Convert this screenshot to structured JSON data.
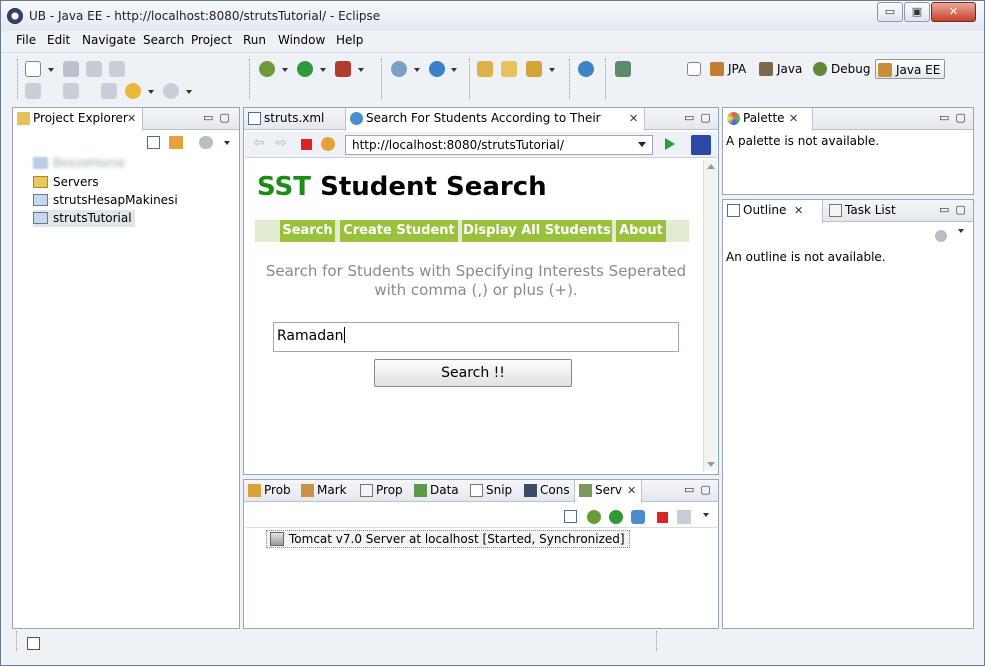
{
  "window": {
    "title": "UB - Java EE - http://localhost:8080/strutsTutorial/ - Eclipse",
    "controls": [
      "▭",
      "▣",
      "✕"
    ]
  },
  "menu": [
    "File",
    "Edit",
    "Navigate",
    "Search",
    "Project",
    "Run",
    "Window",
    "Help"
  ],
  "perspectives": [
    {
      "label": "JPA",
      "icon": "jpa-perspective-icon"
    },
    {
      "label": "Java",
      "icon": "java-perspective-icon"
    },
    {
      "label": "Debug",
      "icon": "debug-perspective-icon"
    },
    {
      "label": "Java EE",
      "icon": "javaee-perspective-icon",
      "active": true
    }
  ],
  "project_explorer": {
    "tab": "Project Explorer",
    "items": [
      {
        "label": "BeezeHome",
        "blurred": true
      },
      {
        "label": "Servers"
      },
      {
        "label": "strutsHesapMakinesi"
      },
      {
        "label": "strutsTutorial",
        "selected": true
      }
    ]
  },
  "editor": {
    "tabs": [
      {
        "label": "struts.xml",
        "icon": "xml-file-icon"
      },
      {
        "label": "Search For Students According to Their Interests",
        "icon": "globe-icon",
        "active": true
      }
    ],
    "url": "http://localhost:8080/strutsTutorial/"
  },
  "web_page": {
    "title_accent": "SST",
    "title_rest": "Student Search",
    "nav": [
      "Search",
      "Create Student",
      "Display All Students",
      "About"
    ],
    "lead_text": "Search for Students with Specifying Interests Seperated with comma (,) or plus (+).",
    "search_value": "Ramadan",
    "search_button": "Search !!"
  },
  "palette": {
    "tab": "Palette",
    "message": "A palette is not available."
  },
  "outline": {
    "tabs": [
      "Outline",
      "Task List"
    ],
    "message": "An outline is not available."
  },
  "bottom_panel": {
    "tabs": [
      "Prob",
      "Mark",
      "Prop",
      "Data",
      "Snip",
      "Cons",
      "Serv"
    ],
    "server_entry": "Tomcat v7.0 Server at localhost  [Started, Synchronized]"
  },
  "colors": {
    "sst_green": "#1d8c17",
    "nav_green": "#99c13c",
    "nav_strip": "#e2ecd2",
    "chrome": "#eef2f7"
  }
}
